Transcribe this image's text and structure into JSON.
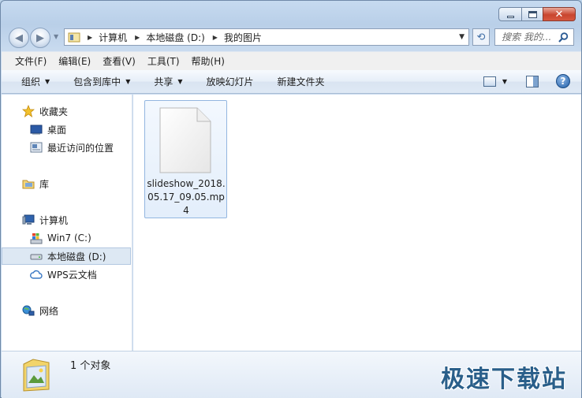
{
  "window": {
    "close_glyph": "✕"
  },
  "breadcrumb": [
    "计算机",
    "本地磁盘 (D:)",
    "我的图片"
  ],
  "search": {
    "placeholder": "搜索 我的..."
  },
  "menu": [
    "文件(F)",
    "编辑(E)",
    "查看(V)",
    "工具(T)",
    "帮助(H)"
  ],
  "toolbar": {
    "organize": "组织",
    "include_library": "包含到库中",
    "share": "共享",
    "slideshow": "放映幻灯片",
    "new_folder": "新建文件夹",
    "help_glyph": "?"
  },
  "nav": {
    "favorites": "收藏夹",
    "desktop": "桌面",
    "recent": "最近访问的位置",
    "libraries": "库",
    "computer": "计算机",
    "drive_c": "Win7 (C:)",
    "drive_d": "本地磁盘 (D:)",
    "wps": "WPS云文档",
    "network": "网络"
  },
  "files": [
    {
      "name": "slideshow_2018.05.17_09.05.mp4"
    }
  ],
  "status": {
    "count": "1 个对象"
  },
  "watermark": "极速下载站",
  "colors": {
    "accent": "#3f6ea6",
    "selection": "#dde8f3",
    "close": "#c9452f"
  }
}
